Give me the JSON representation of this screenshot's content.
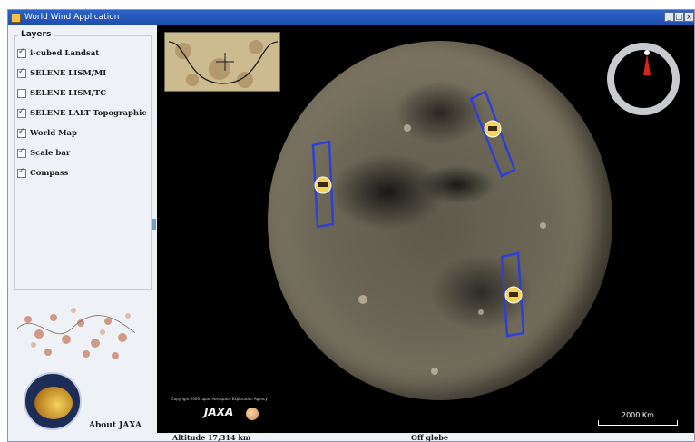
{
  "window": {
    "title": "World Wind Application",
    "minimize_glyph": "_",
    "maximize_glyph": "□",
    "close_glyph": "×"
  },
  "layers_panel": {
    "title": "Layers",
    "items": [
      {
        "label": "i-cubed Landsat",
        "checked": true
      },
      {
        "label": "SELENE LISM/MI",
        "checked": true
      },
      {
        "label": "SELENE LISM/TC",
        "checked": false
      },
      {
        "label": "SELENE LALT Topographic",
        "checked": true
      },
      {
        "label": "World Map",
        "checked": true
      },
      {
        "label": "Scale bar",
        "checked": true
      },
      {
        "label": "Compass",
        "checked": true
      }
    ]
  },
  "about": {
    "label": "About JAXA"
  },
  "globe": {
    "copyright": "Copyright 2003 Japan Aerospace Exploration Agency",
    "agency_mark": "JAXA",
    "scale_label": "2000 Km"
  },
  "status": {
    "altitude": "Altitude  17,314 km",
    "position": "Off globe"
  },
  "colors": {
    "titlebar": "#2a63c8",
    "compass_needle": "#d4241c",
    "footprint_outline": "#2f3fd6"
  }
}
